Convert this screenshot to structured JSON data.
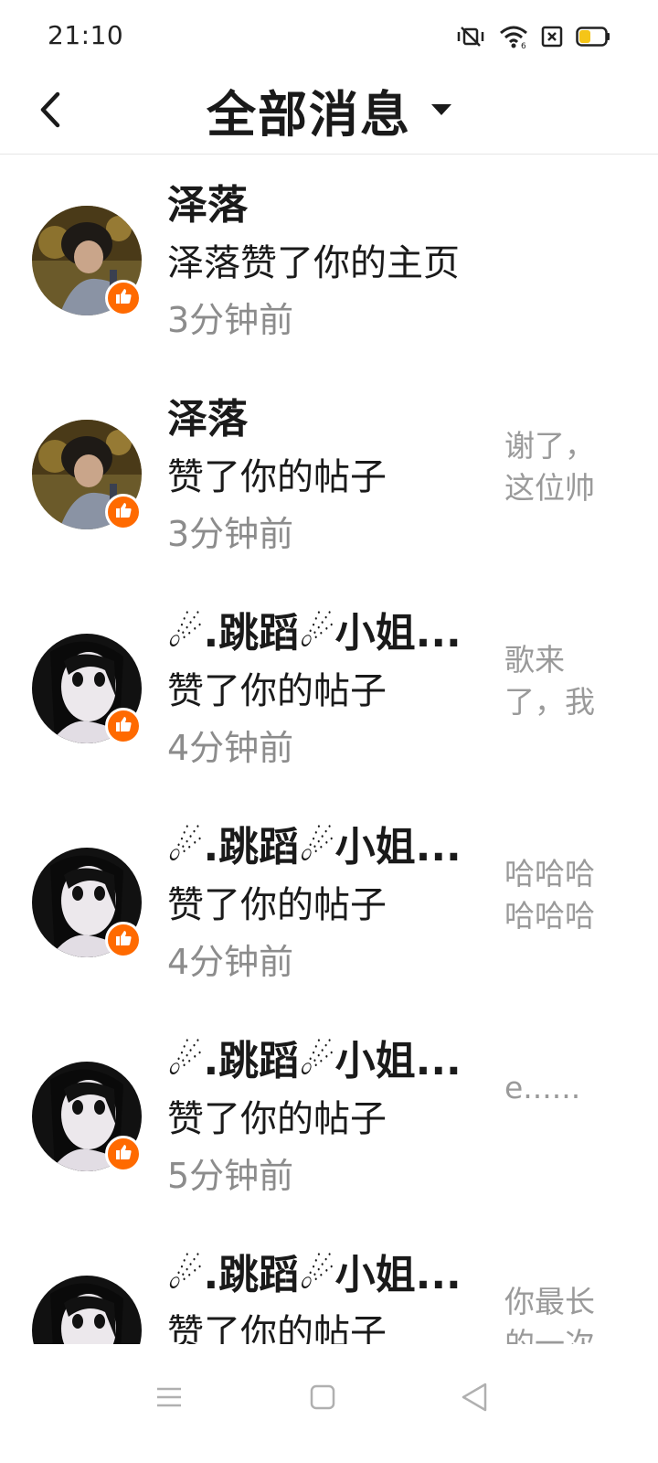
{
  "status_bar": {
    "time": "21:10",
    "icons": [
      "vibrate-mute-icon",
      "wifi-icon",
      "sim-card-icon",
      "battery-icon"
    ],
    "battery_color": "#f5c518"
  },
  "header": {
    "back_icon": "back-arrow-icon",
    "title": "全部消息",
    "dropdown_icon": "caret-down-icon"
  },
  "colors": {
    "like_badge": "#ff6a00",
    "text_primary": "#1a1a1a",
    "text_secondary": "#8c8c8c",
    "divider": "#e6e6e6"
  },
  "messages": [
    {
      "name": "泽落",
      "action": "泽落赞了你的主页",
      "time": "3分钟前",
      "preview": "",
      "avatar": "avatar-photo-boy"
    },
    {
      "name": "泽落",
      "action": "赞了你的帖子",
      "time": "3分钟前",
      "preview": "谢了，这位帅哥",
      "avatar": "avatar-photo-boy"
    },
    {
      "name": "☄.跳蹈☄小姐...",
      "action": "赞了你的帖子",
      "time": "4分钟前",
      "preview": "歌来了，我忘了",
      "avatar": "avatar-anime-girl"
    },
    {
      "name": "☄.跳蹈☄小姐...",
      "action": "赞了你的帖子",
      "time": "4分钟前",
      "preview": "哈哈哈哈哈哈哈哈",
      "avatar": "avatar-anime-girl"
    },
    {
      "name": "☄.跳蹈☄小姐...",
      "action": "赞了你的帖子",
      "time": "5分钟前",
      "preview": "e......",
      "avatar": "avatar-anime-girl"
    },
    {
      "name": "☄.跳蹈☄小姐...",
      "action": "赞了你的帖子",
      "time": "",
      "preview": "你最长的一次",
      "avatar": "avatar-anime-girl"
    }
  ],
  "nav_bar": {
    "items": [
      "menu-icon",
      "home-square-icon",
      "back-triangle-icon"
    ]
  }
}
